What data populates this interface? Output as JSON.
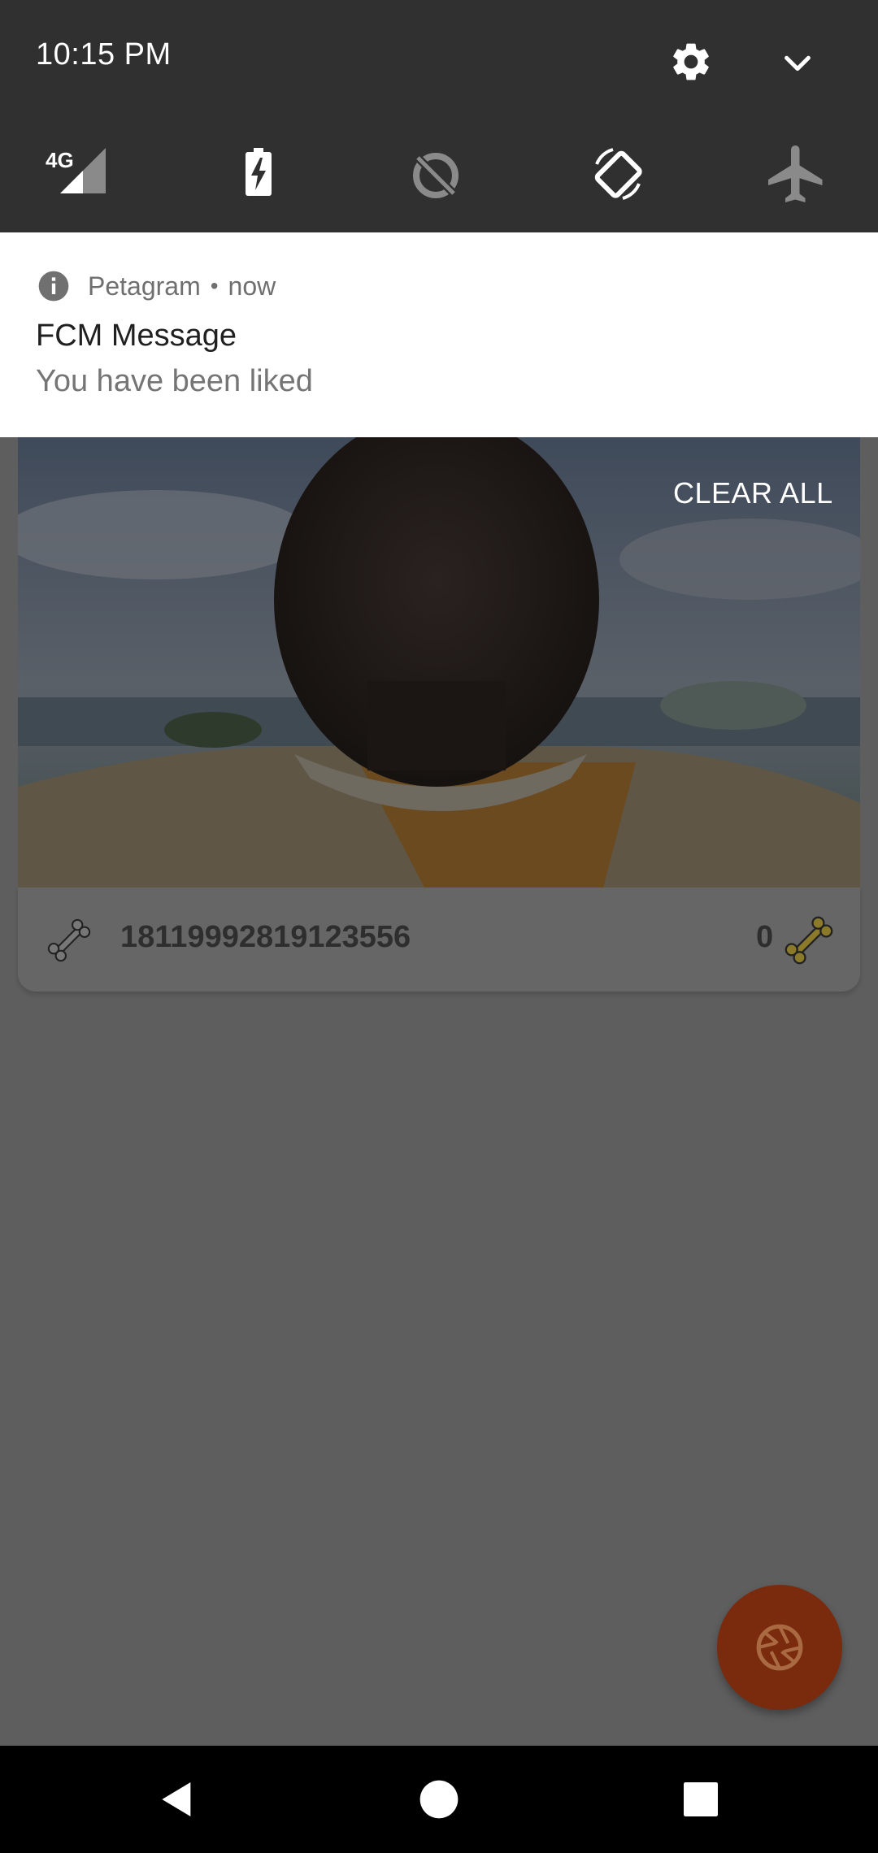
{
  "status": {
    "time": "10:15 PM",
    "network_label": "4G"
  },
  "quick_tiles": [
    {
      "name": "mobile-data-tile",
      "icon": "signal-4g-icon"
    },
    {
      "name": "battery-saver-tile",
      "icon": "battery-charging-icon"
    },
    {
      "name": "data-saver-tile",
      "icon": "data-saver-off-icon"
    },
    {
      "name": "auto-rotate-tile",
      "icon": "screen-rotation-icon"
    },
    {
      "name": "airplane-mode-tile",
      "icon": "airplane-icon"
    }
  ],
  "notification": {
    "app_name": "Petagram",
    "separator": "•",
    "time": "now",
    "title": "FCM Message",
    "body": "You have been liked"
  },
  "clear_all_label": "CLEAR ALL",
  "post": {
    "id_text": "18119992819123556",
    "likes": "0"
  },
  "colors": {
    "qs_background": "#303030",
    "scrim": "#5e5e5e",
    "fab": "#7a2a0d",
    "bone_accent": "#8a7a2a"
  }
}
